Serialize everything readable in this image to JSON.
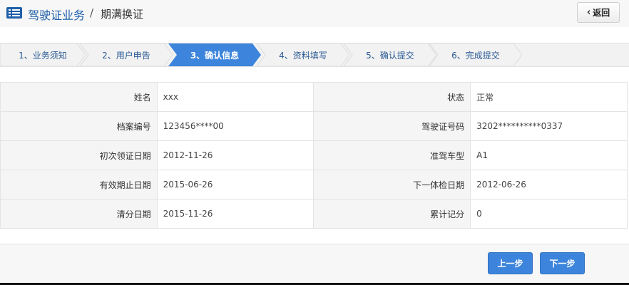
{
  "header": {
    "section": "驾驶证业务",
    "separator": "/",
    "subtitle": "期满换证",
    "back_label": "返回"
  },
  "steps": [
    {
      "label": "1、业务须知",
      "active": false
    },
    {
      "label": "2、用户申告",
      "active": false
    },
    {
      "label": "3、确认信息",
      "active": true
    },
    {
      "label": "4、资料填写",
      "active": false
    },
    {
      "label": "5、确认提交",
      "active": false
    },
    {
      "label": "6、完成提交",
      "active": false
    }
  ],
  "info": [
    {
      "label_left": "姓名",
      "value_left": "xxx",
      "label_right": "状态",
      "value_right": "正常"
    },
    {
      "label_left": "档案编号",
      "value_left": "123456****00",
      "label_right": "驾驶证号码",
      "value_right": "3202**********0337"
    },
    {
      "label_left": "初次领证日期",
      "value_left": "2012-11-26",
      "label_right": "准驾车型",
      "value_right": "A1"
    },
    {
      "label_left": "有效期止日期",
      "value_left": "2015-06-26",
      "label_right": "下一体检日期",
      "value_right": "2012-06-26"
    },
    {
      "label_left": "清分日期",
      "value_left": "2015-11-26",
      "label_right": "累计记分",
      "value_right": "0"
    }
  ],
  "footer": {
    "prev_label": "上一步",
    "next_label": "下一步"
  },
  "colors": {
    "accent": "#3d85dc",
    "brand": "#1e5fa8",
    "step_active": "#3d85dc",
    "step_inactive": "#f2f2f2"
  }
}
